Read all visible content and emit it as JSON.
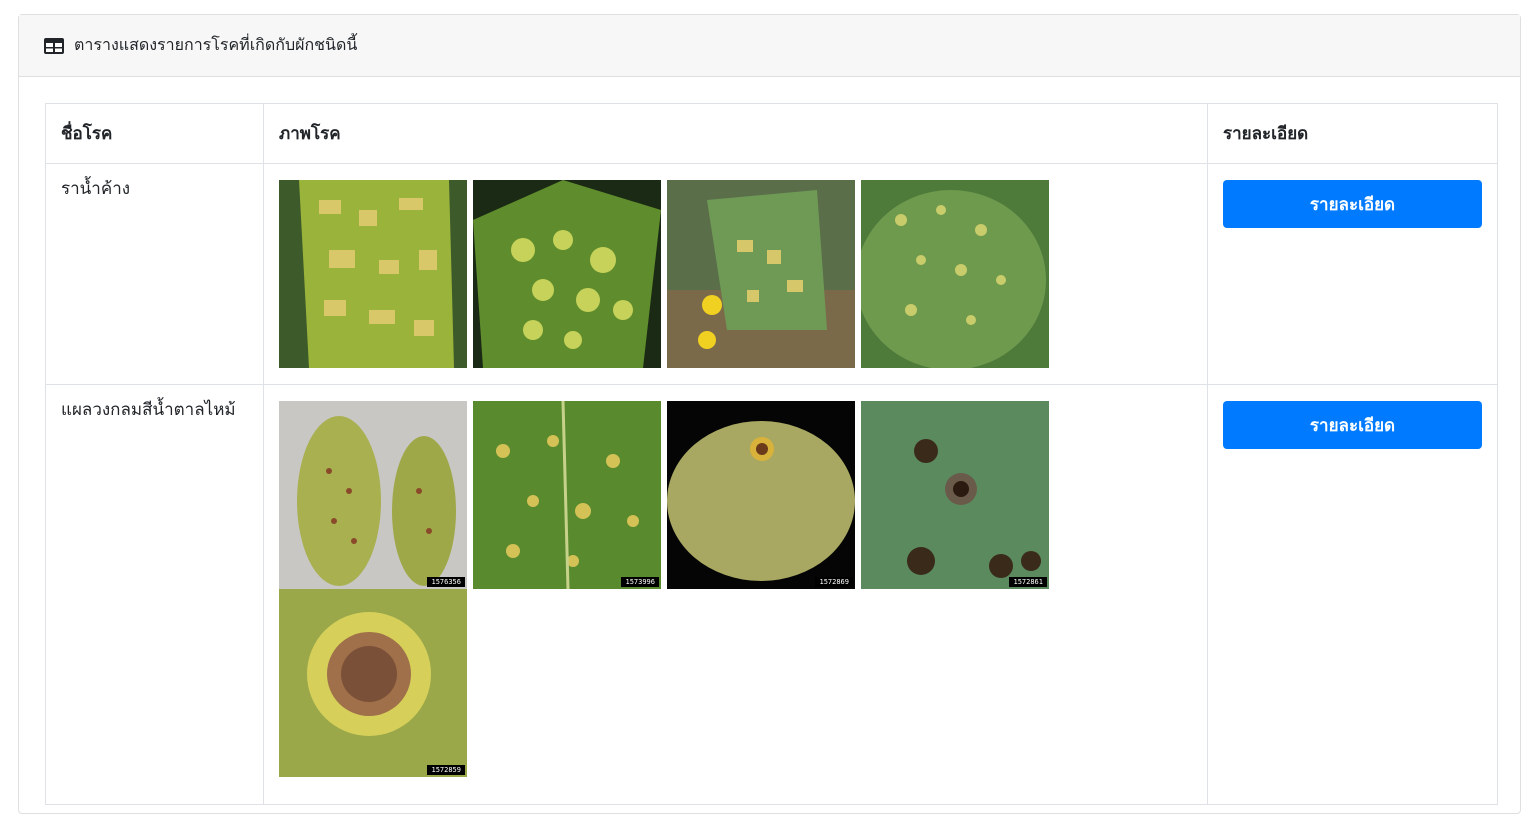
{
  "card": {
    "title": "ตารางแสดงรายการโรคที่เกิดกับผักชนิดนี้",
    "icon": "table-icon"
  },
  "table": {
    "headers": [
      "ชื่อโรค",
      "ภาพโรค",
      "รายละเอียด"
    ],
    "rows": [
      {
        "name": "ราน้ำค้าง",
        "images": [
          {
            "icon": "downy-mildew-leaf-photo-1",
            "tag": ""
          },
          {
            "icon": "downy-mildew-leaf-photo-2",
            "tag": ""
          },
          {
            "icon": "downy-mildew-leaf-photo-3",
            "tag": ""
          },
          {
            "icon": "downy-mildew-leaf-photo-4",
            "tag": ""
          }
        ],
        "button": "รายละเอียด"
      },
      {
        "name": "แผลวงกลมสีน้ำตาลไหม้",
        "images": [
          {
            "icon": "leaf-spot-photo-1",
            "tag": "1576356"
          },
          {
            "icon": "leaf-spot-photo-2",
            "tag": "1573996"
          },
          {
            "icon": "leaf-spot-photo-3",
            "tag": "1572869"
          },
          {
            "icon": "leaf-spot-photo-4",
            "tag": "1572861"
          },
          {
            "icon": "leaf-spot-photo-5",
            "tag": "1572859"
          }
        ],
        "button": "รายละเอียด"
      }
    ]
  },
  "colors": {
    "button": "#007bff",
    "header_bg": "#f7f7f7",
    "border": "#dee2e6"
  }
}
